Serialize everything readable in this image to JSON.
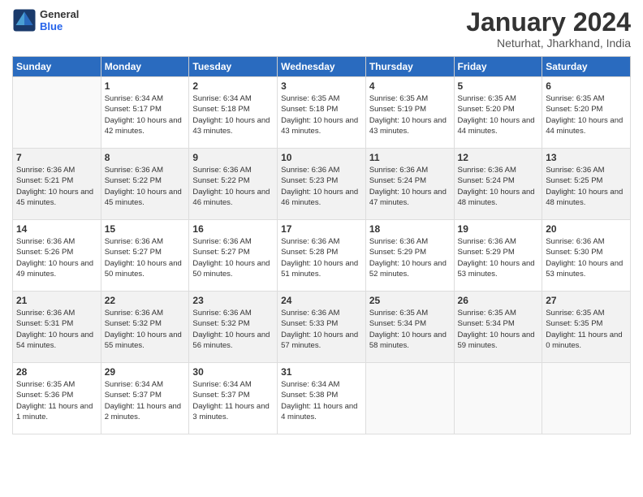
{
  "logo": {
    "general": "General",
    "blue": "Blue"
  },
  "header": {
    "month_title": "January 2024",
    "location": "Neturhat, Jharkhand, India"
  },
  "days_of_week": [
    "Sunday",
    "Monday",
    "Tuesday",
    "Wednesday",
    "Thursday",
    "Friday",
    "Saturday"
  ],
  "weeks": [
    [
      {
        "day": "",
        "info": ""
      },
      {
        "day": "1",
        "info": "Sunrise: 6:34 AM\nSunset: 5:17 PM\nDaylight: 10 hours\nand 42 minutes."
      },
      {
        "day": "2",
        "info": "Sunrise: 6:34 AM\nSunset: 5:18 PM\nDaylight: 10 hours\nand 43 minutes."
      },
      {
        "day": "3",
        "info": "Sunrise: 6:35 AM\nSunset: 5:18 PM\nDaylight: 10 hours\nand 43 minutes."
      },
      {
        "day": "4",
        "info": "Sunrise: 6:35 AM\nSunset: 5:19 PM\nDaylight: 10 hours\nand 43 minutes."
      },
      {
        "day": "5",
        "info": "Sunrise: 6:35 AM\nSunset: 5:20 PM\nDaylight: 10 hours\nand 44 minutes."
      },
      {
        "day": "6",
        "info": "Sunrise: 6:35 AM\nSunset: 5:20 PM\nDaylight: 10 hours\nand 44 minutes."
      }
    ],
    [
      {
        "day": "7",
        "info": "Sunrise: 6:36 AM\nSunset: 5:21 PM\nDaylight: 10 hours\nand 45 minutes."
      },
      {
        "day": "8",
        "info": "Sunrise: 6:36 AM\nSunset: 5:22 PM\nDaylight: 10 hours\nand 45 minutes."
      },
      {
        "day": "9",
        "info": "Sunrise: 6:36 AM\nSunset: 5:22 PM\nDaylight: 10 hours\nand 46 minutes."
      },
      {
        "day": "10",
        "info": "Sunrise: 6:36 AM\nSunset: 5:23 PM\nDaylight: 10 hours\nand 46 minutes."
      },
      {
        "day": "11",
        "info": "Sunrise: 6:36 AM\nSunset: 5:24 PM\nDaylight: 10 hours\nand 47 minutes."
      },
      {
        "day": "12",
        "info": "Sunrise: 6:36 AM\nSunset: 5:24 PM\nDaylight: 10 hours\nand 48 minutes."
      },
      {
        "day": "13",
        "info": "Sunrise: 6:36 AM\nSunset: 5:25 PM\nDaylight: 10 hours\nand 48 minutes."
      }
    ],
    [
      {
        "day": "14",
        "info": "Sunrise: 6:36 AM\nSunset: 5:26 PM\nDaylight: 10 hours\nand 49 minutes."
      },
      {
        "day": "15",
        "info": "Sunrise: 6:36 AM\nSunset: 5:27 PM\nDaylight: 10 hours\nand 50 minutes."
      },
      {
        "day": "16",
        "info": "Sunrise: 6:36 AM\nSunset: 5:27 PM\nDaylight: 10 hours\nand 50 minutes."
      },
      {
        "day": "17",
        "info": "Sunrise: 6:36 AM\nSunset: 5:28 PM\nDaylight: 10 hours\nand 51 minutes."
      },
      {
        "day": "18",
        "info": "Sunrise: 6:36 AM\nSunset: 5:29 PM\nDaylight: 10 hours\nand 52 minutes."
      },
      {
        "day": "19",
        "info": "Sunrise: 6:36 AM\nSunset: 5:29 PM\nDaylight: 10 hours\nand 53 minutes."
      },
      {
        "day": "20",
        "info": "Sunrise: 6:36 AM\nSunset: 5:30 PM\nDaylight: 10 hours\nand 53 minutes."
      }
    ],
    [
      {
        "day": "21",
        "info": "Sunrise: 6:36 AM\nSunset: 5:31 PM\nDaylight: 10 hours\nand 54 minutes."
      },
      {
        "day": "22",
        "info": "Sunrise: 6:36 AM\nSunset: 5:32 PM\nDaylight: 10 hours\nand 55 minutes."
      },
      {
        "day": "23",
        "info": "Sunrise: 6:36 AM\nSunset: 5:32 PM\nDaylight: 10 hours\nand 56 minutes."
      },
      {
        "day": "24",
        "info": "Sunrise: 6:36 AM\nSunset: 5:33 PM\nDaylight: 10 hours\nand 57 minutes."
      },
      {
        "day": "25",
        "info": "Sunrise: 6:35 AM\nSunset: 5:34 PM\nDaylight: 10 hours\nand 58 minutes."
      },
      {
        "day": "26",
        "info": "Sunrise: 6:35 AM\nSunset: 5:34 PM\nDaylight: 10 hours\nand 59 minutes."
      },
      {
        "day": "27",
        "info": "Sunrise: 6:35 AM\nSunset: 5:35 PM\nDaylight: 11 hours\nand 0 minutes."
      }
    ],
    [
      {
        "day": "28",
        "info": "Sunrise: 6:35 AM\nSunset: 5:36 PM\nDaylight: 11 hours\nand 1 minute."
      },
      {
        "day": "29",
        "info": "Sunrise: 6:34 AM\nSunset: 5:37 PM\nDaylight: 11 hours\nand 2 minutes."
      },
      {
        "day": "30",
        "info": "Sunrise: 6:34 AM\nSunset: 5:37 PM\nDaylight: 11 hours\nand 3 minutes."
      },
      {
        "day": "31",
        "info": "Sunrise: 6:34 AM\nSunset: 5:38 PM\nDaylight: 11 hours\nand 4 minutes."
      },
      {
        "day": "",
        "info": ""
      },
      {
        "day": "",
        "info": ""
      },
      {
        "day": "",
        "info": ""
      }
    ]
  ]
}
